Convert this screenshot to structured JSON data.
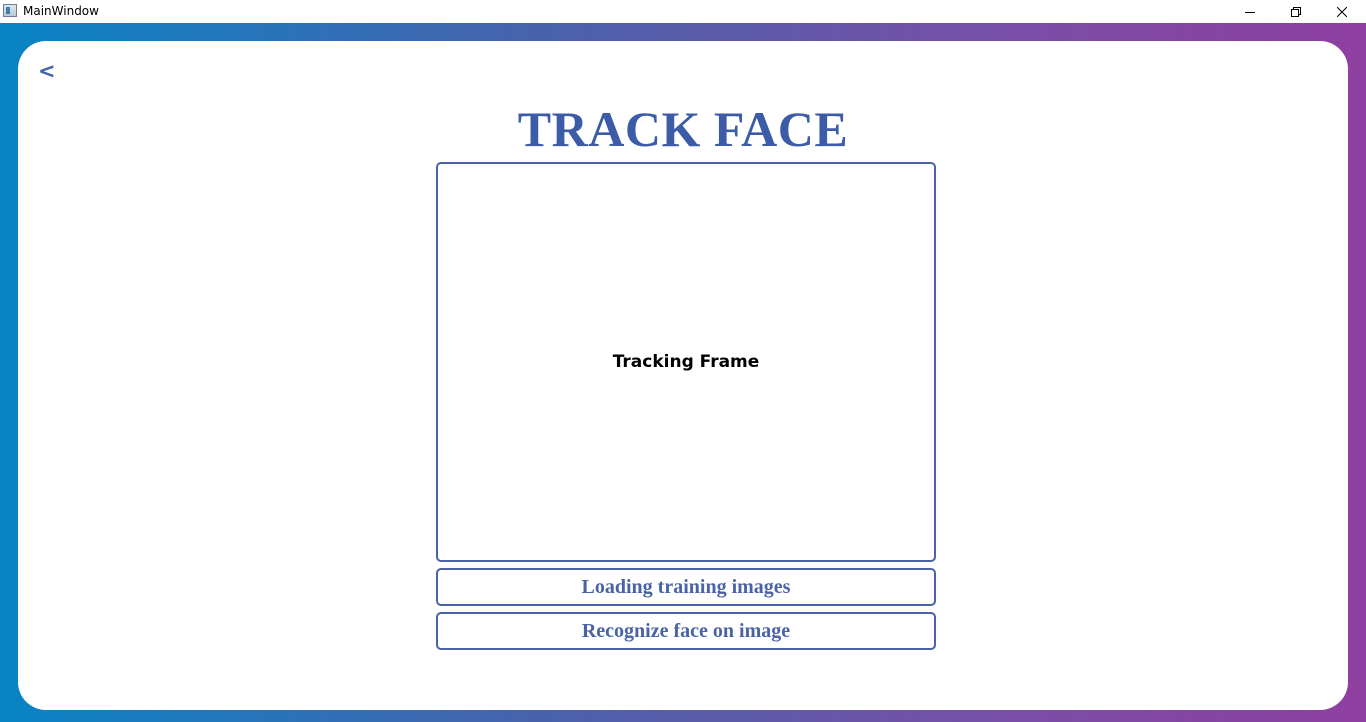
{
  "window": {
    "title": "MainWindow",
    "controls": {
      "minimize_icon": "minimize-icon",
      "restore_icon": "restore-icon",
      "close_icon": "close-icon"
    }
  },
  "theme": {
    "accent": "#4a63a6",
    "title_color": "#3c5ca8",
    "gradient_start": "#0884c4",
    "gradient_end": "#8e3f9f"
  },
  "nav": {
    "back_label": "<"
  },
  "main": {
    "title": "TRACK FACE",
    "frame_label": "Tracking Frame",
    "load_button_label": "Loading training images",
    "recognize_button_label": "Recognize face on image"
  }
}
